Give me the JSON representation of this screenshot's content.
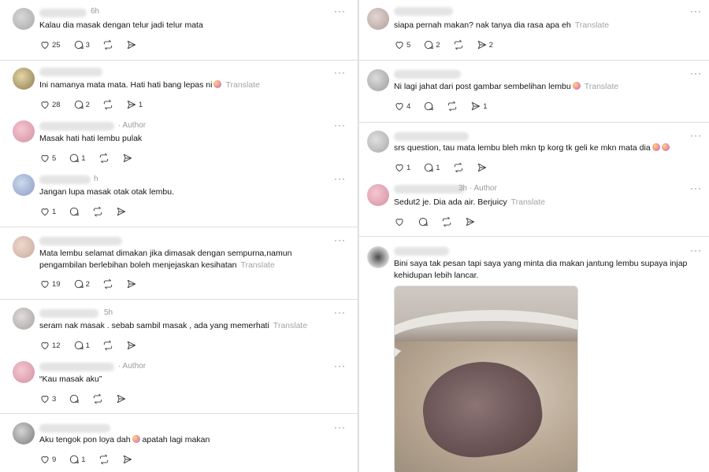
{
  "left": [
    {
      "time": "6h",
      "text": "Kalau dia masak dengan telur jadi telur mata",
      "translate": "",
      "emoji": false,
      "likes": "25",
      "replies": "3",
      "reposts": "",
      "shares": ""
    },
    {
      "time": "",
      "text": "Ini namanya mata mata. Hati hati bang lepas ni",
      "translate": "Translate",
      "emoji": true,
      "likes": "28",
      "replies": "2",
      "reposts": "",
      "shares": "1"
    },
    {
      "time": "· Author",
      "text": "Masak hati hati lembu pulak",
      "translate": "",
      "emoji": false,
      "likes": "5",
      "replies": "1",
      "reposts": "",
      "shares": ""
    },
    {
      "time": "h",
      "text": "Jangan lupa masak otak otak lembu.",
      "translate": "",
      "emoji": false,
      "likes": "1",
      "replies": "",
      "reposts": "",
      "shares": ""
    },
    {
      "time": "",
      "text": "Mata lembu selamat dimakan jika dimasak dengan sempurna,namun",
      "text2": "pengambilan berlebihan boleh menjejaskan kesihatan",
      "translate": "Translate",
      "emoji": false,
      "likes": "19",
      "replies": "2",
      "reposts": "",
      "shares": ""
    },
    {
      "time": "5h",
      "text": "seram nak masak . sebab sambil masak , ada yang memerhati",
      "translate": "Translate",
      "emoji": false,
      "likes": "12",
      "replies": "1",
      "reposts": "",
      "shares": ""
    },
    {
      "time": "· Author",
      "text": "“Kau masak aku”",
      "translate": "",
      "emoji": false,
      "likes": "3",
      "replies": "",
      "reposts": "",
      "shares": ""
    },
    {
      "time": "",
      "text": "Aku tengok pon loya dah",
      "text_after": "apatah lagi makan",
      "translate": "",
      "emoji": true,
      "likes": "9",
      "replies": "1",
      "reposts": "",
      "shares": ""
    }
  ],
  "right": [
    {
      "time": "",
      "text": "siapa pernah makan? nak tanya dia rasa apa eh",
      "translate": "Translate",
      "emoji": false,
      "likes": "5",
      "replies": "2",
      "reposts": "",
      "shares": "2"
    },
    {
      "time": "",
      "text": "Ni lagi jahat dari post gambar sembelihan lembu",
      "translate": "Translate",
      "emoji": true,
      "likes": "4",
      "replies": "",
      "reposts": "",
      "shares": "1"
    },
    {
      "time": "",
      "text": "srs question, tau mata lembu bleh mkn tp korg tk geli ke mkn mata dia",
      "translate": "",
      "emoji": true,
      "likes": "1",
      "replies": "1",
      "reposts": "",
      "shares": ""
    },
    {
      "time": "3h · Author",
      "text": "Sedut2 je. Dia ada air. Berjuicy",
      "translate": "Translate",
      "emoji": false,
      "likes": "",
      "replies": "",
      "reposts": "",
      "shares": ""
    },
    {
      "time": "",
      "text": "Bini saya tak pesan tapi saya yang minta dia makan jantung lembu supaya injap",
      "text2": "kehidupan lebih lancar.",
      "translate": "",
      "emoji": false,
      "likes": "",
      "replies": "",
      "reposts": "",
      "shares": ""
    }
  ],
  "more_icon": "···",
  "colors": {
    "text": "#141414",
    "muted": "#9a9a9a",
    "divider": "#dedede"
  }
}
